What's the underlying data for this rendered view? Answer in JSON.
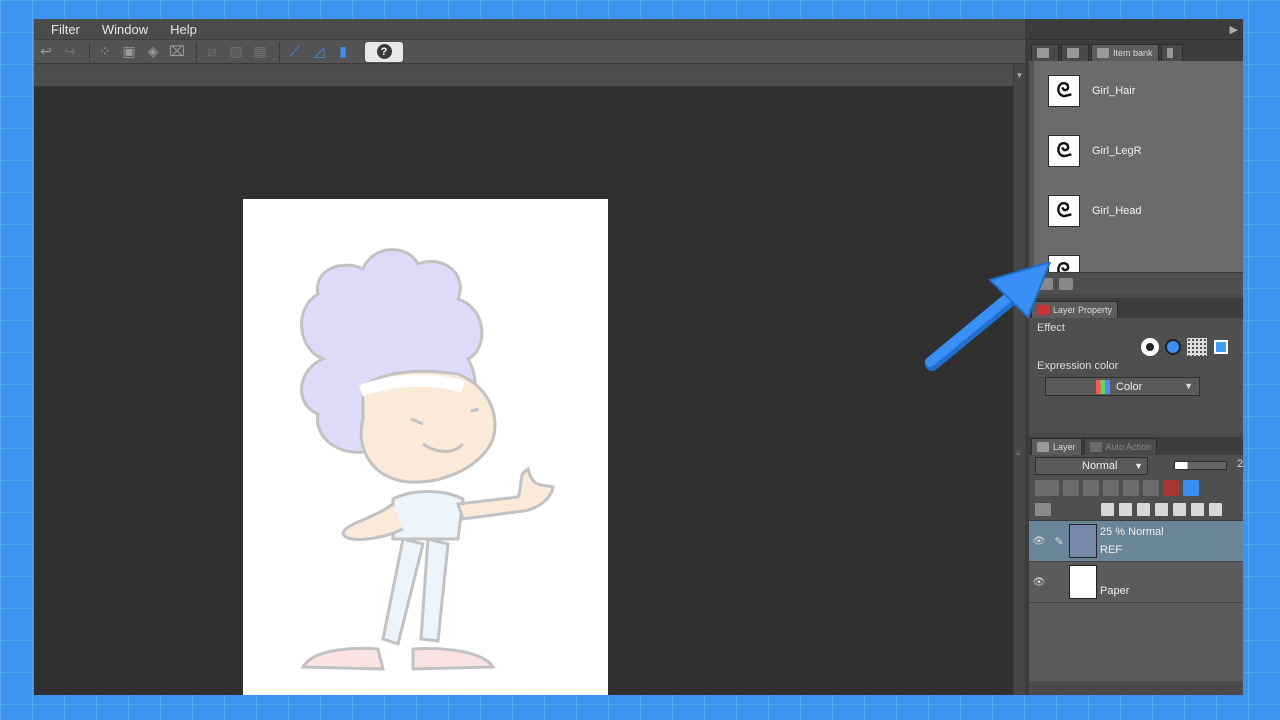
{
  "menu": [
    "Filter",
    "Window",
    "Help"
  ],
  "toolbar": {
    "help_label": "?"
  },
  "item_bank": {
    "tab_label": "Item bank",
    "items": [
      {
        "name": "Girl_Hair"
      },
      {
        "name": "Girl_LegR"
      },
      {
        "name": "Girl_Head"
      }
    ]
  },
  "layer_property": {
    "tab_label": "Layer Property",
    "effect_label": "Effect",
    "expression_color_label": "Expression color",
    "expression_color_value": "Color"
  },
  "layer_panel": {
    "tab_label": "Layer",
    "tab2_label": "Auto Action",
    "blend_mode": "Normal",
    "opacity_display": "2",
    "opacity_fraction": 0.25,
    "layers": [
      {
        "mode": "25 % Normal",
        "name": "REF",
        "selected": true
      },
      {
        "name": "Paper",
        "selected": false
      }
    ]
  },
  "colors": {
    "accent": "#3b95f0",
    "arrow": "#3a8ff5",
    "selected_layer": "#6b8598"
  }
}
